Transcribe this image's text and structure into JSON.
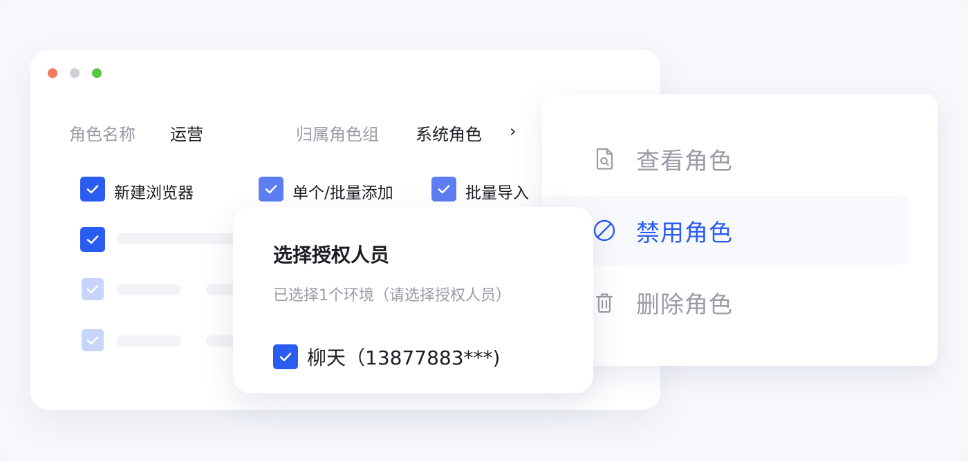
{
  "window": {
    "role_name_label": "角色名称",
    "role_name_value": "运营",
    "role_group_label": "归属角色组",
    "role_group_value": "系统角色",
    "chevron": "›"
  },
  "permissions": [
    {
      "label": "新建浏览器",
      "checked": true
    },
    {
      "label": "单个/批量添加",
      "checked": true
    },
    {
      "label": "批量导入",
      "checked": true
    }
  ],
  "menu": {
    "items": [
      {
        "label": "查看角色",
        "icon": "file-search-icon"
      },
      {
        "label": "禁用角色",
        "icon": "ban-icon",
        "active": true
      },
      {
        "label": "删除角色",
        "icon": "trash-icon"
      }
    ]
  },
  "dialog": {
    "title": "选择授权人员",
    "subtitle": "已选择1个环境（请选择授权人员）",
    "person": "柳天（13877883***)"
  },
  "colors": {
    "accent": "#2b5cf2",
    "muted_text": "#9a9ca6",
    "text": "#1c1d22",
    "dot_red": "#f07b62",
    "dot_gray": "#cfd1d6",
    "dot_green": "#55c744"
  }
}
